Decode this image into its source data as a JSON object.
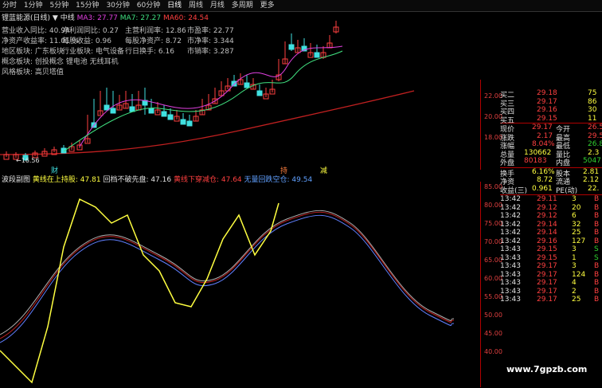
{
  "toolbar": {
    "items": [
      "分时",
      "1分钟",
      "5分钟",
      "15分钟",
      "30分钟",
      "60分钟",
      "日线",
      "周线",
      "月线",
      "多周期",
      "更多"
    ]
  },
  "title": {
    "name": "锂蓝能源(日线)",
    "sep": "▼",
    "line": "中线",
    "ma5": "MA3: 27.77",
    "ma7": "MA7: 27.27",
    "ma60": "MA60: 24.54"
  },
  "info": [
    {
      "k": "营业收入同比:",
      "v": "40.94"
    },
    {
      "k": "净利润同比:",
      "v": "0.27"
    },
    {
      "k": "主营利润率:",
      "v": "12.86"
    },
    {
      "k": "市盈率:",
      "v": "22.77"
    },
    {
      "k": "净资产收益率:",
      "v": "11.01 %"
    },
    {
      "k": "每股收益:",
      "v": "0.96"
    },
    {
      "k": "每股净资产:",
      "v": "8.72"
    },
    {
      "k": "市净率:",
      "v": "3.344"
    },
    {
      "k": "地区板块:",
      "v": "广东板块"
    },
    {
      "k": "行业板块:",
      "v": "电气设备"
    },
    {
      "k": "行日换手:",
      "v": "6.16"
    },
    {
      "k": "市销率:",
      "v": "3.287"
    },
    {
      "k": "概念板块:",
      "v": "创投概念 锂电池 无线耳机"
    },
    {
      "k": "风格板块:",
      "v": "高贝塔值"
    }
  ],
  "main_axis": [
    "22.00",
    "20.00",
    "18.00"
  ],
  "low_marker": "16.56",
  "markers": {
    "m1": "财",
    "m2": "持",
    "m3": "减"
  },
  "sub_legend": {
    "name": "波段副图",
    "l1": "黄线在上持股: 47.81",
    "l2": "回档不破先盘: 47.16",
    "l3": "黄线下穿减仓: 47.64",
    "l4": "无量回跌空仓: 49.54"
  },
  "sub_axis": [
    "85.00",
    "80.00",
    "75.00",
    "70.00",
    "65.00",
    "60.00",
    "55.00",
    "50.00",
    "45.00",
    "40.00"
  ],
  "quotes": [
    {
      "label": "买二",
      "price": "29.18",
      "vol": "75"
    },
    {
      "label": "买三",
      "price": "29.17",
      "vol": "86"
    },
    {
      "label": "买四",
      "price": "29.16",
      "vol": "30"
    },
    {
      "label": "买五",
      "price": "29.15",
      "vol": "11"
    }
  ],
  "stats": [
    {
      "k1": "现价",
      "v1": "29.17",
      "k2": "今开",
      "v2": "26.5"
    },
    {
      "k1": "涨跌",
      "v1": "2.17",
      "k2": "最高",
      "v2": "29.5"
    },
    {
      "k1": "涨幅",
      "v1": "8.04%",
      "k2": "最低",
      "v2": "26.8"
    },
    {
      "k1": "总量",
      "v1": "130662",
      "k2": "量比",
      "v2": "2.3"
    },
    {
      "k1": "外盘",
      "v1": "80183",
      "k2": "内盘",
      "v2": "5047"
    }
  ],
  "stats2": [
    {
      "k1": "换手",
      "v1": "6.16%",
      "k2": "股本",
      "v2": "2.81"
    },
    {
      "k1": "净资",
      "v1": "8.72",
      "k2": "流通",
      "v2": "2.12"
    },
    {
      "k1": "收益(三)",
      "v1": "0.961",
      "k2": "PE(动)",
      "v2": "22."
    }
  ],
  "ticks": [
    {
      "t": "13:42",
      "p": "29.11",
      "v": "3",
      "s": "B"
    },
    {
      "t": "13:42",
      "p": "29.12",
      "v": "20",
      "s": "B"
    },
    {
      "t": "13:42",
      "p": "29.12",
      "v": "6",
      "s": "B"
    },
    {
      "t": "13:42",
      "p": "29.14",
      "v": "32",
      "s": "B"
    },
    {
      "t": "13:42",
      "p": "29.14",
      "v": "25",
      "s": "B"
    },
    {
      "t": "13:42",
      "p": "29.16",
      "v": "127",
      "s": "B"
    },
    {
      "t": "13:43",
      "p": "29.15",
      "v": "3",
      "s": "S"
    },
    {
      "t": "13:43",
      "p": "29.15",
      "v": "1",
      "s": "S"
    },
    {
      "t": "13:43",
      "p": "29.17",
      "v": "3",
      "s": "B"
    },
    {
      "t": "13:43",
      "p": "29.17",
      "v": "124",
      "s": "B"
    },
    {
      "t": "13:43",
      "p": "29.17",
      "v": "4",
      "s": "B"
    },
    {
      "t": "13:43",
      "p": "29.17",
      "v": "2",
      "s": "B"
    },
    {
      "t": "13:43",
      "p": "29.17",
      "v": "25",
      "s": "B"
    }
  ],
  "watermark": "www.7gpzb.com",
  "colors": {
    "up": "#ff4040",
    "down": "#40e0e0",
    "ma5": "#e040e0",
    "ma7": "#40e080",
    "ma60": "#c02020",
    "yellow": "#ffff40"
  }
}
